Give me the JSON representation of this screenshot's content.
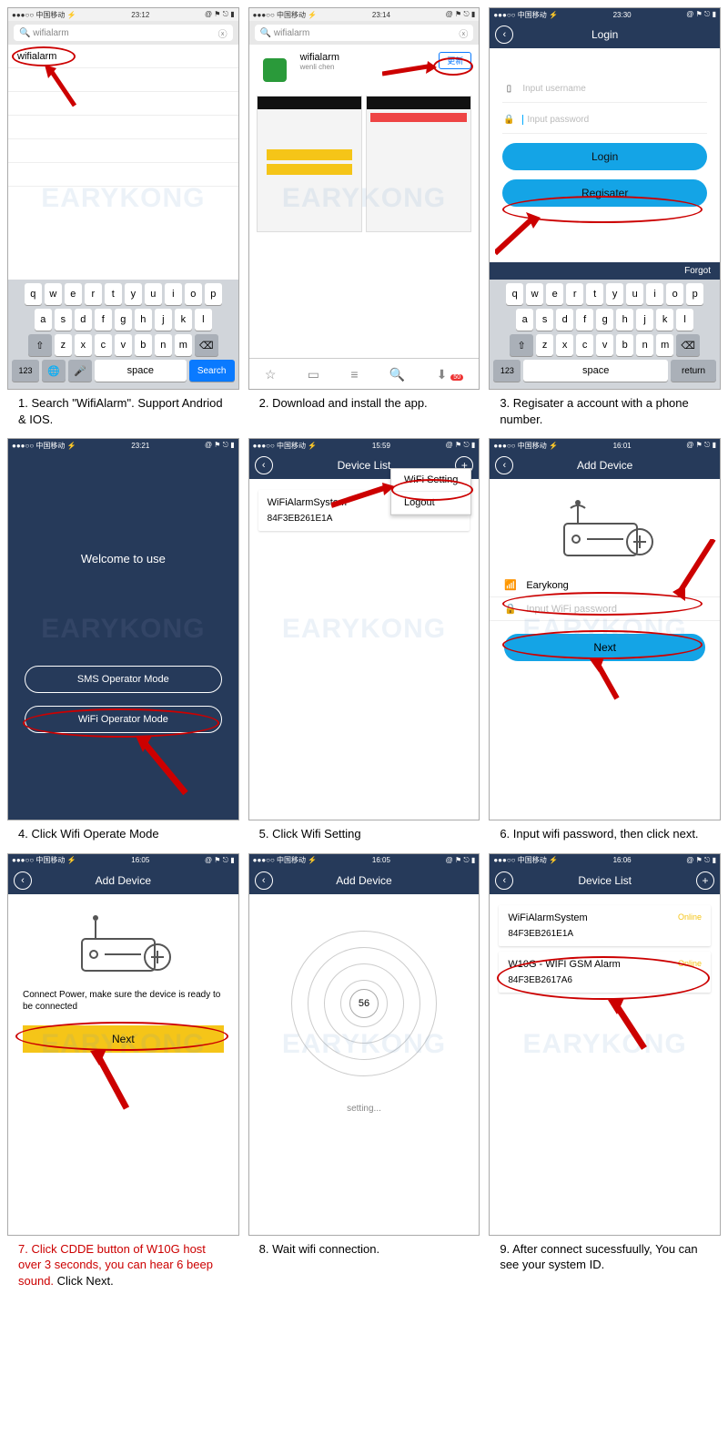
{
  "watermark": "EARYKONG",
  "status": {
    "carrier": "中国移动",
    "icons": "@ ⚑ ⎋ ▮"
  },
  "screens": [
    {
      "time": "23:12",
      "search_text": "wifialarm",
      "result": "wifialarm",
      "kb_search": "Search",
      "kb_space": "space",
      "kb_123": "123",
      "caption": "1. Search \"WifiAlarm\". Support Andriod & IOS."
    },
    {
      "time": "23:14",
      "search_text": "wifialarm",
      "app_name": "wifialarm",
      "app_sub": "wenli chen",
      "update_btn": "更新",
      "tab_badge": "50",
      "caption": "2. Download and install the app."
    },
    {
      "time": "23:30",
      "title": "Login",
      "ph_user": "Input username",
      "ph_pass": "Input password",
      "btn_login": "Login",
      "btn_reg": "Regisater",
      "forgot": "Forgot",
      "kb_space": "space",
      "kb_return": "return",
      "kb_123": "123",
      "caption": "3. Regisater a account with a phone number."
    },
    {
      "time": "23:21",
      "welcome": "Welcome to use",
      "mode_sms": "SMS Operator Mode",
      "mode_wifi": "WiFi Operator Mode",
      "caption": "4. Click Wifi Operate Mode"
    },
    {
      "time": "15:59",
      "title": "Device List",
      "dev_name": "WiFiAlarmSystem",
      "dev_mac": "84F3EB261E1A",
      "popup_wifi": "WiFi Setting",
      "popup_logout": "Logout",
      "caption": "5. Click Wifi Setting"
    },
    {
      "time": "16:01",
      "title": "Add Device",
      "ssid": "Earykong",
      "ph_pass": "Input WiFi password",
      "btn_next": "Next",
      "caption": "6. Input wifi password, then click next."
    },
    {
      "time": "16:05",
      "title": "Add Device",
      "msg": "Connect Power, make sure the device is ready to be connected",
      "btn_next": "Next",
      "caption_red": "7. Click CDDE button of W10G host over 3 seconds, you can hear 6 beep sound.",
      "caption_black": "  Click Next."
    },
    {
      "time": "16:05",
      "title": "Add Device",
      "percent": "56",
      "setting": "setting...",
      "caption": "8. Wait wifi connection."
    },
    {
      "time": "16:06",
      "title": "Device List",
      "d1_name": "WiFiAlarmSystem",
      "d1_mac": "84F3EB261E1A",
      "d1_stat": "Online",
      "d2_name": "W10G - WIFI GSM Alarm",
      "d2_mac": "84F3EB2617A6",
      "d2_stat": "Online",
      "caption": "9. After connect sucessfuully, You can see your system ID."
    }
  ],
  "keys": {
    "row1": [
      "q",
      "w",
      "e",
      "r",
      "t",
      "y",
      "u",
      "i",
      "o",
      "p"
    ],
    "row2": [
      "a",
      "s",
      "d",
      "f",
      "g",
      "h",
      "j",
      "k",
      "l"
    ],
    "row3": [
      "z",
      "x",
      "c",
      "v",
      "b",
      "n",
      "m"
    ]
  }
}
